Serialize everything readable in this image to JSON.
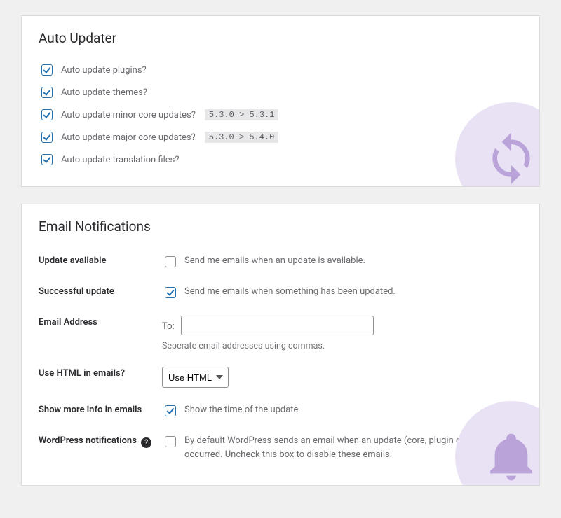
{
  "auto_updater": {
    "title": "Auto Updater",
    "items": [
      {
        "label": "Auto update plugins?",
        "checked": true,
        "badge": null
      },
      {
        "label": "Auto update themes?",
        "checked": true,
        "badge": null
      },
      {
        "label": "Auto update minor core updates?",
        "checked": true,
        "badge": "5.3.0 > 5.3.1"
      },
      {
        "label": "Auto update major core updates?",
        "checked": true,
        "badge": "5.3.0 > 5.4.0"
      },
      {
        "label": "Auto update translation files?",
        "checked": true,
        "badge": null
      }
    ]
  },
  "email": {
    "title": "Email Notifications",
    "update_available": {
      "label": "Update available",
      "checkbox_label": "Send me emails when an update is available.",
      "checked": false
    },
    "successful_update": {
      "label": "Successful update",
      "checkbox_label": "Send me emails when something has been updated.",
      "checked": true
    },
    "address": {
      "label": "Email Address",
      "to": "To:",
      "value": "",
      "hint": "Seperate email addresses using commas."
    },
    "html": {
      "label": "Use HTML in emails?",
      "selected": "Use HTML"
    },
    "more_info": {
      "label": "Show more info in emails",
      "checkbox_label": "Show the time of the update",
      "checked": true
    },
    "wp_notify": {
      "label": "WordPress notifications",
      "checkbox_label": "By default WordPress sends an email when an update (core, plugin or theme) has occurred. Uncheck this box to disable these emails.",
      "checked": false
    }
  }
}
